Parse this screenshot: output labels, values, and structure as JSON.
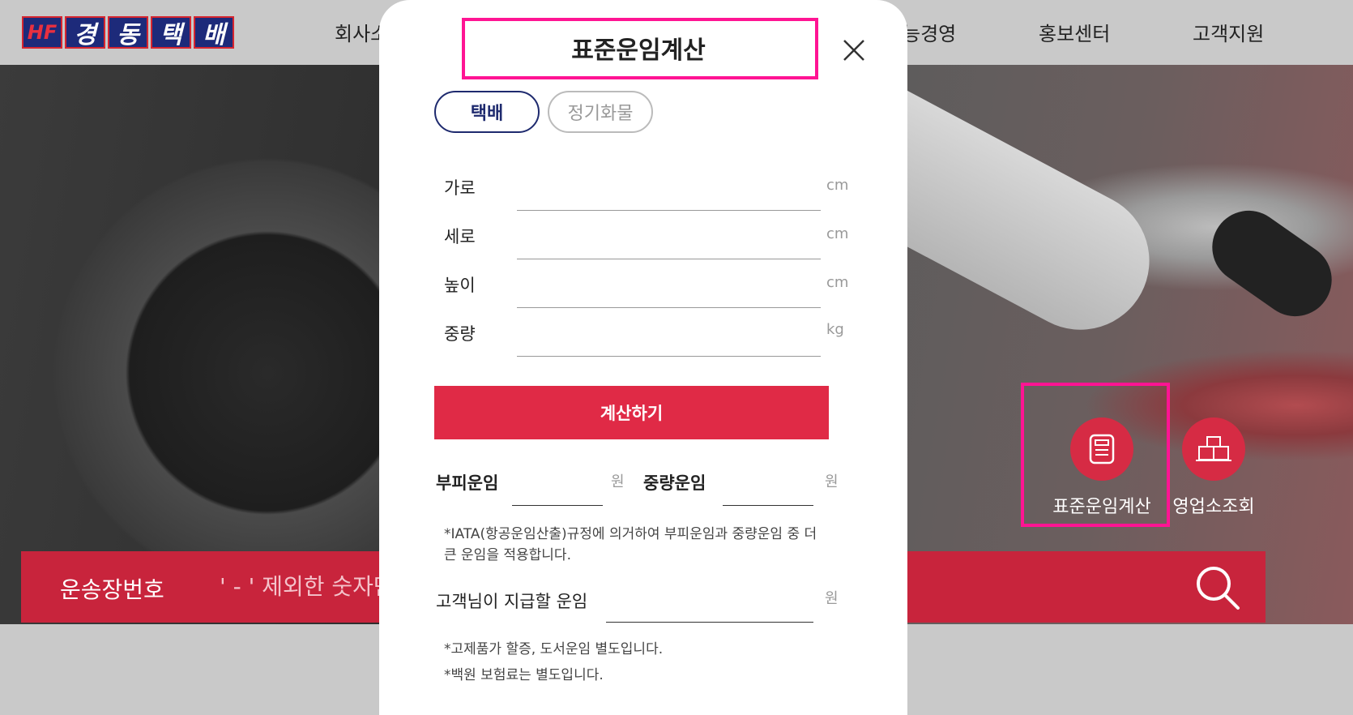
{
  "header": {
    "logo_mark": "HF",
    "logo_chars": [
      "경",
      "동",
      "택",
      "배"
    ],
    "nav": [
      "회사소",
      "능경영",
      "홍보센터",
      "고객지원"
    ]
  },
  "quick_buttons": {
    "calc": {
      "label": "표준운임계산",
      "icon": "calculator-icon"
    },
    "office": {
      "label": "영업소조회",
      "icon": "building-icon"
    }
  },
  "tracking": {
    "label": "운송장번호",
    "placeholder": "' - ' 제외한 숫자만"
  },
  "modal": {
    "title": "표준운임계산",
    "tabs": {
      "parcel": "택배",
      "regular": "정기화물"
    },
    "fields": {
      "width": {
        "label": "가로",
        "unit": "cm",
        "value": ""
      },
      "length": {
        "label": "세로",
        "unit": "cm",
        "value": ""
      },
      "height": {
        "label": "높이",
        "unit": "cm",
        "value": ""
      },
      "weight": {
        "label": "중량",
        "unit": "kg",
        "value": ""
      }
    },
    "calc_button": "계산하기",
    "results": {
      "volume_fare": {
        "label": "부피운임",
        "unit": "원"
      },
      "weight_fare": {
        "label": "중량운임",
        "unit": "원"
      },
      "total_fare": {
        "label": "고객님이 지급할 운임",
        "unit": "원"
      }
    },
    "notes": {
      "iata": "*IATA(항공운임산출)규정에 의거하여 부피운임과 중량운임 중 더 큰 운임을 적용합니다.",
      "premium": "*고제품가 할증, 도서운임 별도입니다.",
      "insurance": "*백원 보험료는 별도입니다."
    }
  },
  "colors": {
    "brand_red": "#e02a46",
    "brand_navy": "#1e2a6e",
    "highlight": "#ff1493"
  }
}
